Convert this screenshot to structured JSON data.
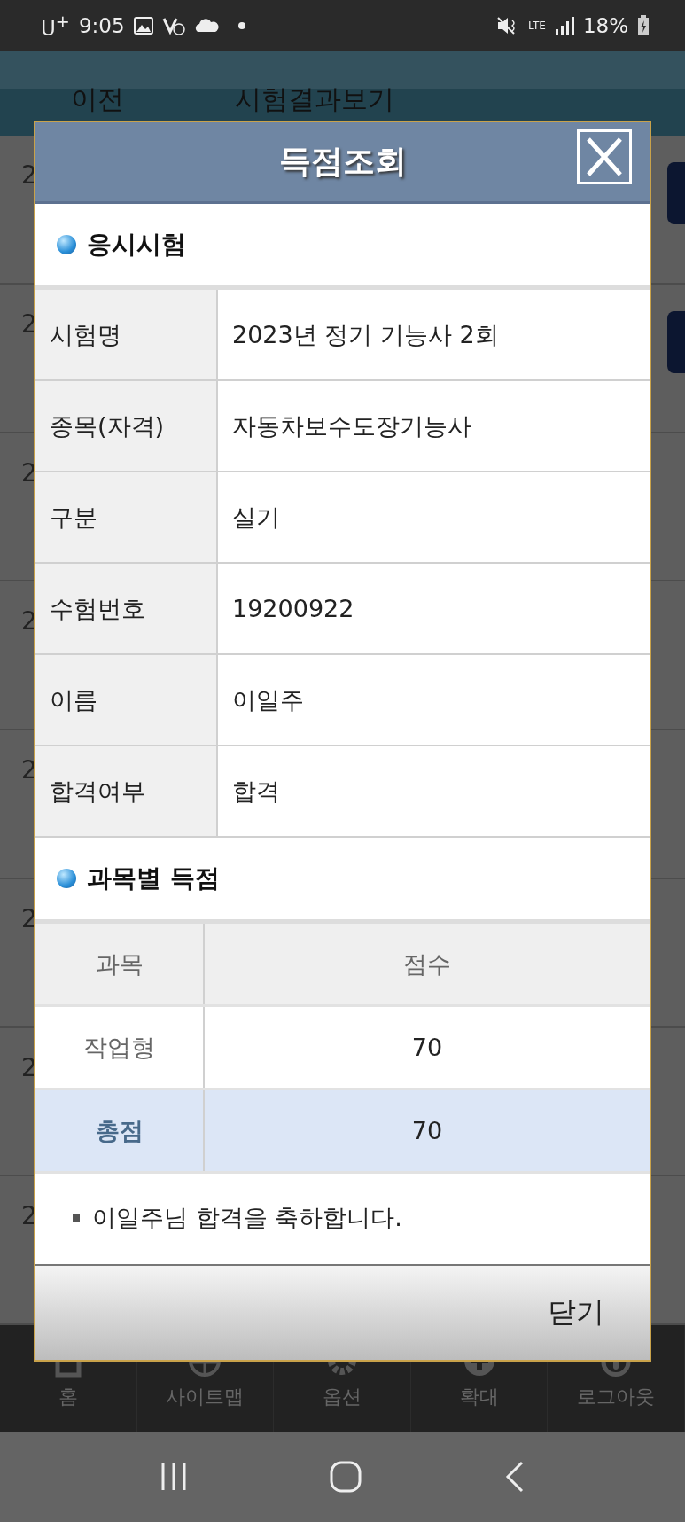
{
  "status_bar": {
    "carrier": "U$^{+}$",
    "time": "9:05",
    "network": "LTE",
    "battery": "18%"
  },
  "app_bar": {
    "back": "이전",
    "title": "시험결과보기"
  },
  "background_rows": [
    {
      "text": "2",
      "button": true
    },
    {
      "text": "2",
      "button": true
    },
    {
      "text": "2",
      "button": false
    },
    {
      "text": "2",
      "button": false
    },
    {
      "text": "2",
      "button": false
    },
    {
      "text": "2",
      "button": false
    },
    {
      "text": "2",
      "button": false
    },
    {
      "text": "2",
      "button": false
    }
  ],
  "bottom_nav": [
    {
      "kind": "home",
      "label": "홈"
    },
    {
      "kind": "globe",
      "label": "사이트맵"
    },
    {
      "kind": "gear",
      "label": "옵션"
    },
    {
      "kind": "plus",
      "label": "확대"
    },
    {
      "kind": "power",
      "label": "로그아웃"
    }
  ],
  "dialog": {
    "title": "득점조회",
    "exam_section": {
      "title": "응시시험",
      "rows": [
        {
          "label": "시험명",
          "value": "2023년 정기 기능사 2회"
        },
        {
          "label": "종목(자격)",
          "value": "자동차보수도장기능사"
        },
        {
          "label": "구분",
          "value": "실기"
        },
        {
          "label": "수험번호",
          "value": "19200922"
        },
        {
          "label": "이름",
          "value": "이일주"
        },
        {
          "label": "합격여부",
          "value": "합격"
        }
      ]
    },
    "score_section": {
      "title": "과목별 득점",
      "rows": [
        {
          "kind": "header",
          "subject": "과목",
          "score": "점수"
        },
        {
          "kind": "subject",
          "subject": "작업형",
          "score": "70"
        },
        {
          "kind": "total",
          "subject": "총점",
          "score": "70"
        }
      ]
    },
    "note": "이일주님 합격을 축하합니다.",
    "buttons": [
      {
        "kind": "blank"
      },
      {
        "kind": "close",
        "label": "닫기"
      }
    ]
  }
}
